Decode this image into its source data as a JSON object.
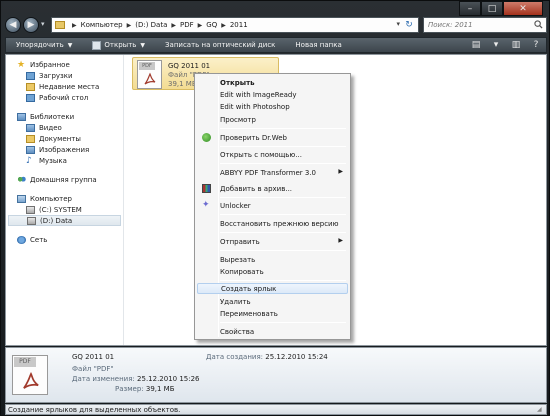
{
  "address": {
    "crumbs": [
      "Компьютер",
      "(D:) Data",
      "PDF",
      "GQ",
      "2011"
    ],
    "search_placeholder": "Поиск: 2011"
  },
  "toolbar": {
    "organize": "Упорядочить",
    "open": "Открыть",
    "burn": "Записать на оптический диск",
    "new_folder": "Новая папка"
  },
  "sidebar": {
    "favorites": {
      "label": "Избранное",
      "items": [
        "Загрузки",
        "Недавние места",
        "Рабочий стол"
      ]
    },
    "libraries": {
      "label": "Библиотеки",
      "items": [
        "Видео",
        "Документы",
        "Изображения",
        "Музыка"
      ]
    },
    "homegroup": {
      "label": "Домашняя группа"
    },
    "computer": {
      "label": "Компьютер",
      "items": [
        "(C:) SYSTEM",
        "(D:) Data"
      ],
      "selected": "(D:) Data"
    },
    "network": {
      "label": "Сеть"
    }
  },
  "file": {
    "name": "GQ 2011 01",
    "type": "Файл \"PDF\"",
    "size": "39,1 МБ",
    "icon_tag": "PDF"
  },
  "context_menu": {
    "items": [
      {
        "label": "Открыть",
        "bold": true
      },
      {
        "label": "Edit with ImageReady"
      },
      {
        "label": "Edit with Photoshop"
      },
      {
        "label": "Просмотр"
      },
      {
        "label": "Проверить Dr.Web",
        "icon": "drweb-icon"
      },
      {
        "label": "Открыть с помощью..."
      },
      {
        "label": "ABBYY PDF Transformer 3.0",
        "submenu": true
      },
      {
        "label": "Добавить в архив...",
        "icon": "archive-icon"
      },
      {
        "label": "Unlocker",
        "icon": "unlocker-icon"
      },
      {
        "label": "Восстановить прежнюю версию"
      },
      {
        "label": "Отправить",
        "submenu": true
      },
      {
        "label": "Вырезать"
      },
      {
        "label": "Копировать"
      },
      {
        "label": "Создать ярлык",
        "highlighted": true
      },
      {
        "label": "Удалить"
      },
      {
        "label": "Переименовать"
      },
      {
        "label": "Свойства"
      }
    ]
  },
  "details": {
    "name": "GQ 2011 01",
    "type": "Файл \"PDF\"",
    "modified_label": "Дата изменения:",
    "modified_value": "25.12.2010 15:26",
    "size_label": "Размер:",
    "size_value": "39,1 МБ",
    "created_label": "Дата создания:",
    "created_value": "25.12.2010 15:24"
  },
  "status_bar": {
    "text": "Создание ярлыков для выделенных объектов."
  }
}
